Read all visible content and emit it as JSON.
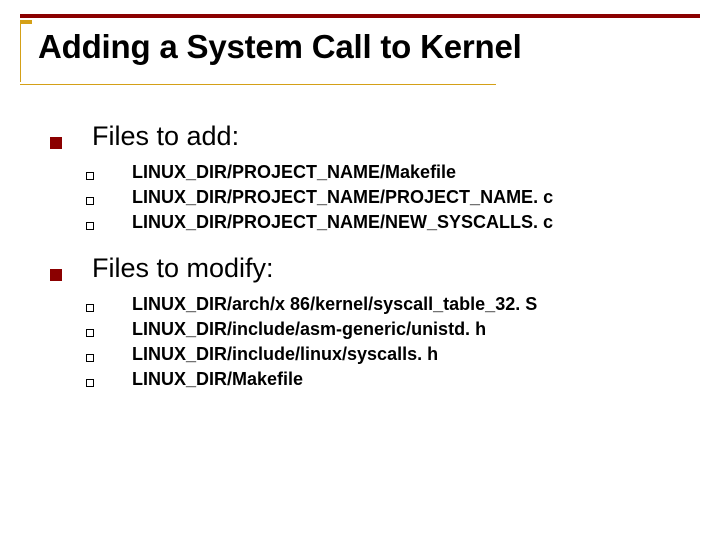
{
  "title": "Adding a System Call to Kernel",
  "sections": [
    {
      "heading": "Files to add:",
      "items": [
        "LINUX_DIR/PROJECT_NAME/Makefile",
        "LINUX_DIR/PROJECT_NAME/PROJECT_NAME. c",
        "LINUX_DIR/PROJECT_NAME/NEW_SYSCALLS. c"
      ]
    },
    {
      "heading": "Files to modify:",
      "items": [
        "LINUX_DIR/arch/x 86/kernel/syscall_table_32. S",
        "LINUX_DIR/include/asm-generic/unistd. h",
        "LINUX_DIR/include/linux/syscalls. h",
        "LINUX_DIR/Makefile"
      ]
    }
  ]
}
